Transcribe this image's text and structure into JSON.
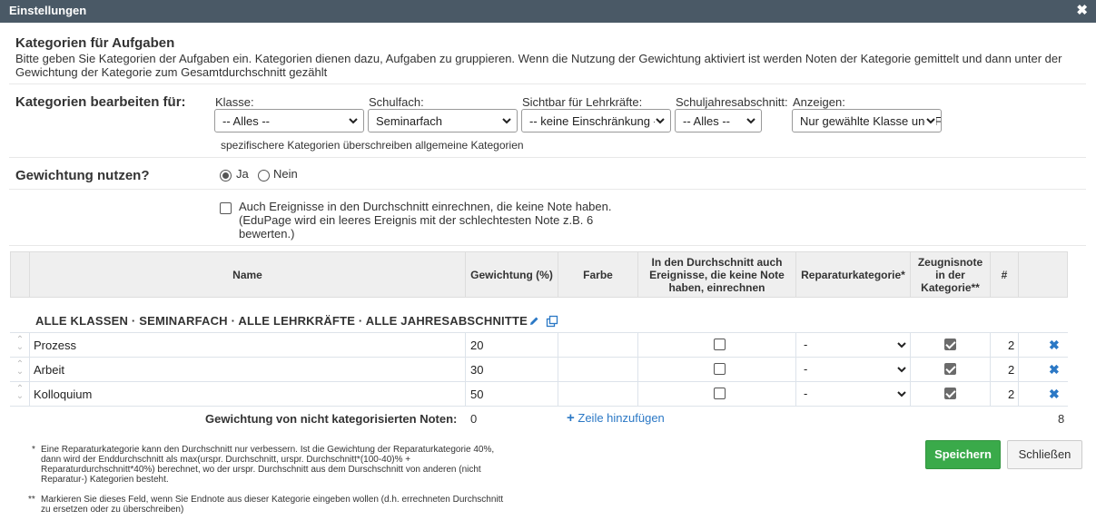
{
  "window": {
    "title": "Einstellungen",
    "close_glyph": "✖"
  },
  "intro": {
    "heading": "Kategorien für Aufgaben",
    "description": "Bitte geben Sie Kategorien der Aufgaben ein. Kategorien dienen dazu, Aufgaben zu gruppieren. Wenn die Nutzung der Gewichtung aktiviert ist werden Noten der Kategorie gemittelt und dann unter der Gewichtung der Kategorie zum Gesamtdurchschnitt gezählt"
  },
  "filters": {
    "section_label": "Kategorien bearbeiten für:",
    "klasse": {
      "label": "Klasse:",
      "value": "-- Alles --"
    },
    "schulfach": {
      "label": "Schulfach:",
      "value": "Seminarfach"
    },
    "sichtbar": {
      "label": "Sichtbar für Lehrkräfte:",
      "value": "-- keine Einschränkung --"
    },
    "abschnitt": {
      "label": "Schuljahresabschnitt:",
      "value": "-- Alles --"
    },
    "anzeigen": {
      "label": "Anzeigen:",
      "value": "Nur gewählte Klasse und Fach"
    },
    "hint": "spezifischere Kategorien überschreiben allgemeine Kategorien"
  },
  "weighting": {
    "label": "Gewichtung nutzen?",
    "yes": "Ja",
    "no": "Nein",
    "selected": "Ja",
    "include_events_text": "Auch Ereignisse in den Durchschnitt einrechnen, die keine Note haben. (EduPage wird ein leeres Ereignis mit der schlechtesten Note z.B. 6 bewerten.)",
    "include_events_checked": false
  },
  "table": {
    "headers": {
      "name": "Name",
      "weight": "Gewichtung (%)",
      "color": "Farbe",
      "include": "In den Durchschnitt auch Ereignisse, die keine Note haben, einrechnen",
      "repair": "Reparaturkategorie*",
      "report": "Zeugnisnote in der Kategorie**",
      "count": "#"
    },
    "group_title": "ALLE KLASSEN · SEMINARFACH · ALLE LEHRKRÄFTE · ALLE JAHRESABSCHNITTE",
    "rows": [
      {
        "name": "Prozess",
        "weight": "20",
        "include": false,
        "repair": "-",
        "report": true,
        "count": "2"
      },
      {
        "name": "Arbeit",
        "weight": "30",
        "include": false,
        "repair": "-",
        "report": true,
        "count": "2"
      },
      {
        "name": "Kolloquium",
        "weight": "50",
        "include": false,
        "repair": "-",
        "report": true,
        "count": "2"
      }
    ],
    "footer": {
      "uncategorized_label": "Gewichtung von nicht kategorisierten Noten:",
      "uncategorized_value": "0",
      "add_row": "Zeile hinzufügen",
      "total_count": "8"
    }
  },
  "footnotes": {
    "repair": "Eine Reparaturkategorie kann den Durchschnitt nur verbessern. Ist die Gewichtung der Reparaturkategorie 40%, dann wird der Enddurchschnitt als max(urspr. Durchschnitt, urspr. Durchschnitt*(100-40)% + Reparaturdurchschnitt*40%) berechnet, wo der urspr. Durchschnitt aus dem Durschschnitt von anderen (nicht Reparatur-) Kategorien besteht.",
    "report": "Markieren Sie dieses Feld, wenn Sie Endnote aus dieser Kategorie eingeben wollen (d.h. errechneten Durchschnitt zu ersetzen oder zu überschreiben)"
  },
  "buttons": {
    "save": "Speichern",
    "close": "Schließen"
  },
  "colors": {
    "titlebar": "#4a5966",
    "accent_blue": "#2b78c5",
    "save_green": "#3aaa4a"
  }
}
